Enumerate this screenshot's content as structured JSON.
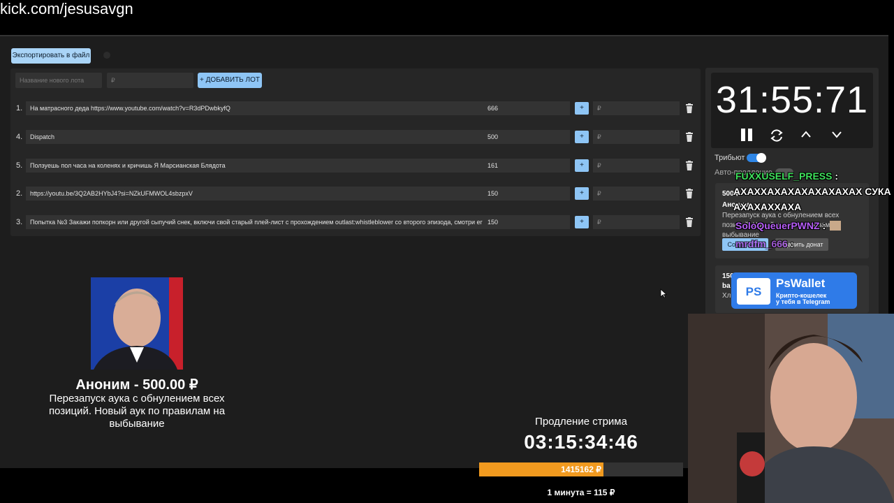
{
  "channel": {
    "url": "kick.com/jesusavgn"
  },
  "toolbar": {
    "export_label": "Экспортировать в файл"
  },
  "new_lot": {
    "name_placeholder": "Название нового лота",
    "amount_placeholder": "₽",
    "add_label": "+ ДОБАВИТЬ ЛОТ"
  },
  "lots": [
    {
      "rank": "1.",
      "name": "На матрасного деда https://www.youtube.com/watch?v=R3dPDwbkyfQ",
      "amount": "666",
      "plus": "+",
      "add_placeholder": "₽"
    },
    {
      "rank": "4.",
      "name": "Dispatch",
      "amount": "500",
      "plus": "+",
      "add_placeholder": "₽"
    },
    {
      "rank": "5.",
      "name": "Ползуешь пол часа на коленях и кричишь Я Марсианская Блядота",
      "amount": "161",
      "plus": "+",
      "add_placeholder": "₽"
    },
    {
      "rank": "2.",
      "name": "https://youtu.be/3Q2AB2HYbJ4?si=NZkUFMWOL4sbzpxV",
      "amount": "150",
      "plus": "+",
      "add_placeholder": "₽"
    },
    {
      "rank": "3.",
      "name": "Попытка №3 Закажи попкорн или другой сыпучий снек, включи свой старый плей-лист с прохождением outlast:whistleblower со второго эпизода, смотри ег",
      "amount": "150",
      "plus": "+",
      "add_placeholder": "₽"
    }
  ],
  "sidebar": {
    "timer": "31:55:71",
    "tribute_label": "Трибьют",
    "auto_label": "Авто-продление",
    "card1": {
      "amount": "500 ₽",
      "author": "Аноним",
      "message": "Перезапуск аука с обнулением всех позиций. Новый аук по правилам на выбывание",
      "create_label": "Создать лот",
      "delete_label": "Удалить донат"
    },
    "card2": {
      "amount": "150",
      "author": "ba",
      "message": "Хл"
    }
  },
  "chat": [
    {
      "user": "FUXXUSELF_PRESS",
      "sep": " :",
      "color": "#3fe05c"
    },
    {
      "text": "АХАХХАХАХАХАХАХАХАХ СУКА",
      "color": "#ffffff"
    },
    {
      "text": "АХАХАХХАХА",
      "color": "#ffffff"
    },
    {
      "user": "SoloQueuerPWNZ",
      "sep": " :",
      "color": "#b65ef7"
    },
    {
      "user": "mrdfm_666",
      "sep": " :",
      "color": "#b65ef7"
    }
  ],
  "ad": {
    "title": "PsWallet",
    "line1": "Крипто-кошелек",
    "line2": "у тебя в Telegram",
    "logo": "PS"
  },
  "donation": {
    "name": "Аноним - 500.00 ₽",
    "message": "Перезапуск аука с обнулением всех позиций. Новый аук по правилам на выбывание"
  },
  "extension": {
    "label": "Продление стрима",
    "timer": "03:15:34:46",
    "progress_text": "1415162 ₽",
    "progress": 0.61,
    "rate": "1 минута = 115 ₽"
  },
  "colors": {
    "accent": "#8ec5f5",
    "progress": "#f19a1f",
    "toggle_on": "#2f86e6"
  }
}
